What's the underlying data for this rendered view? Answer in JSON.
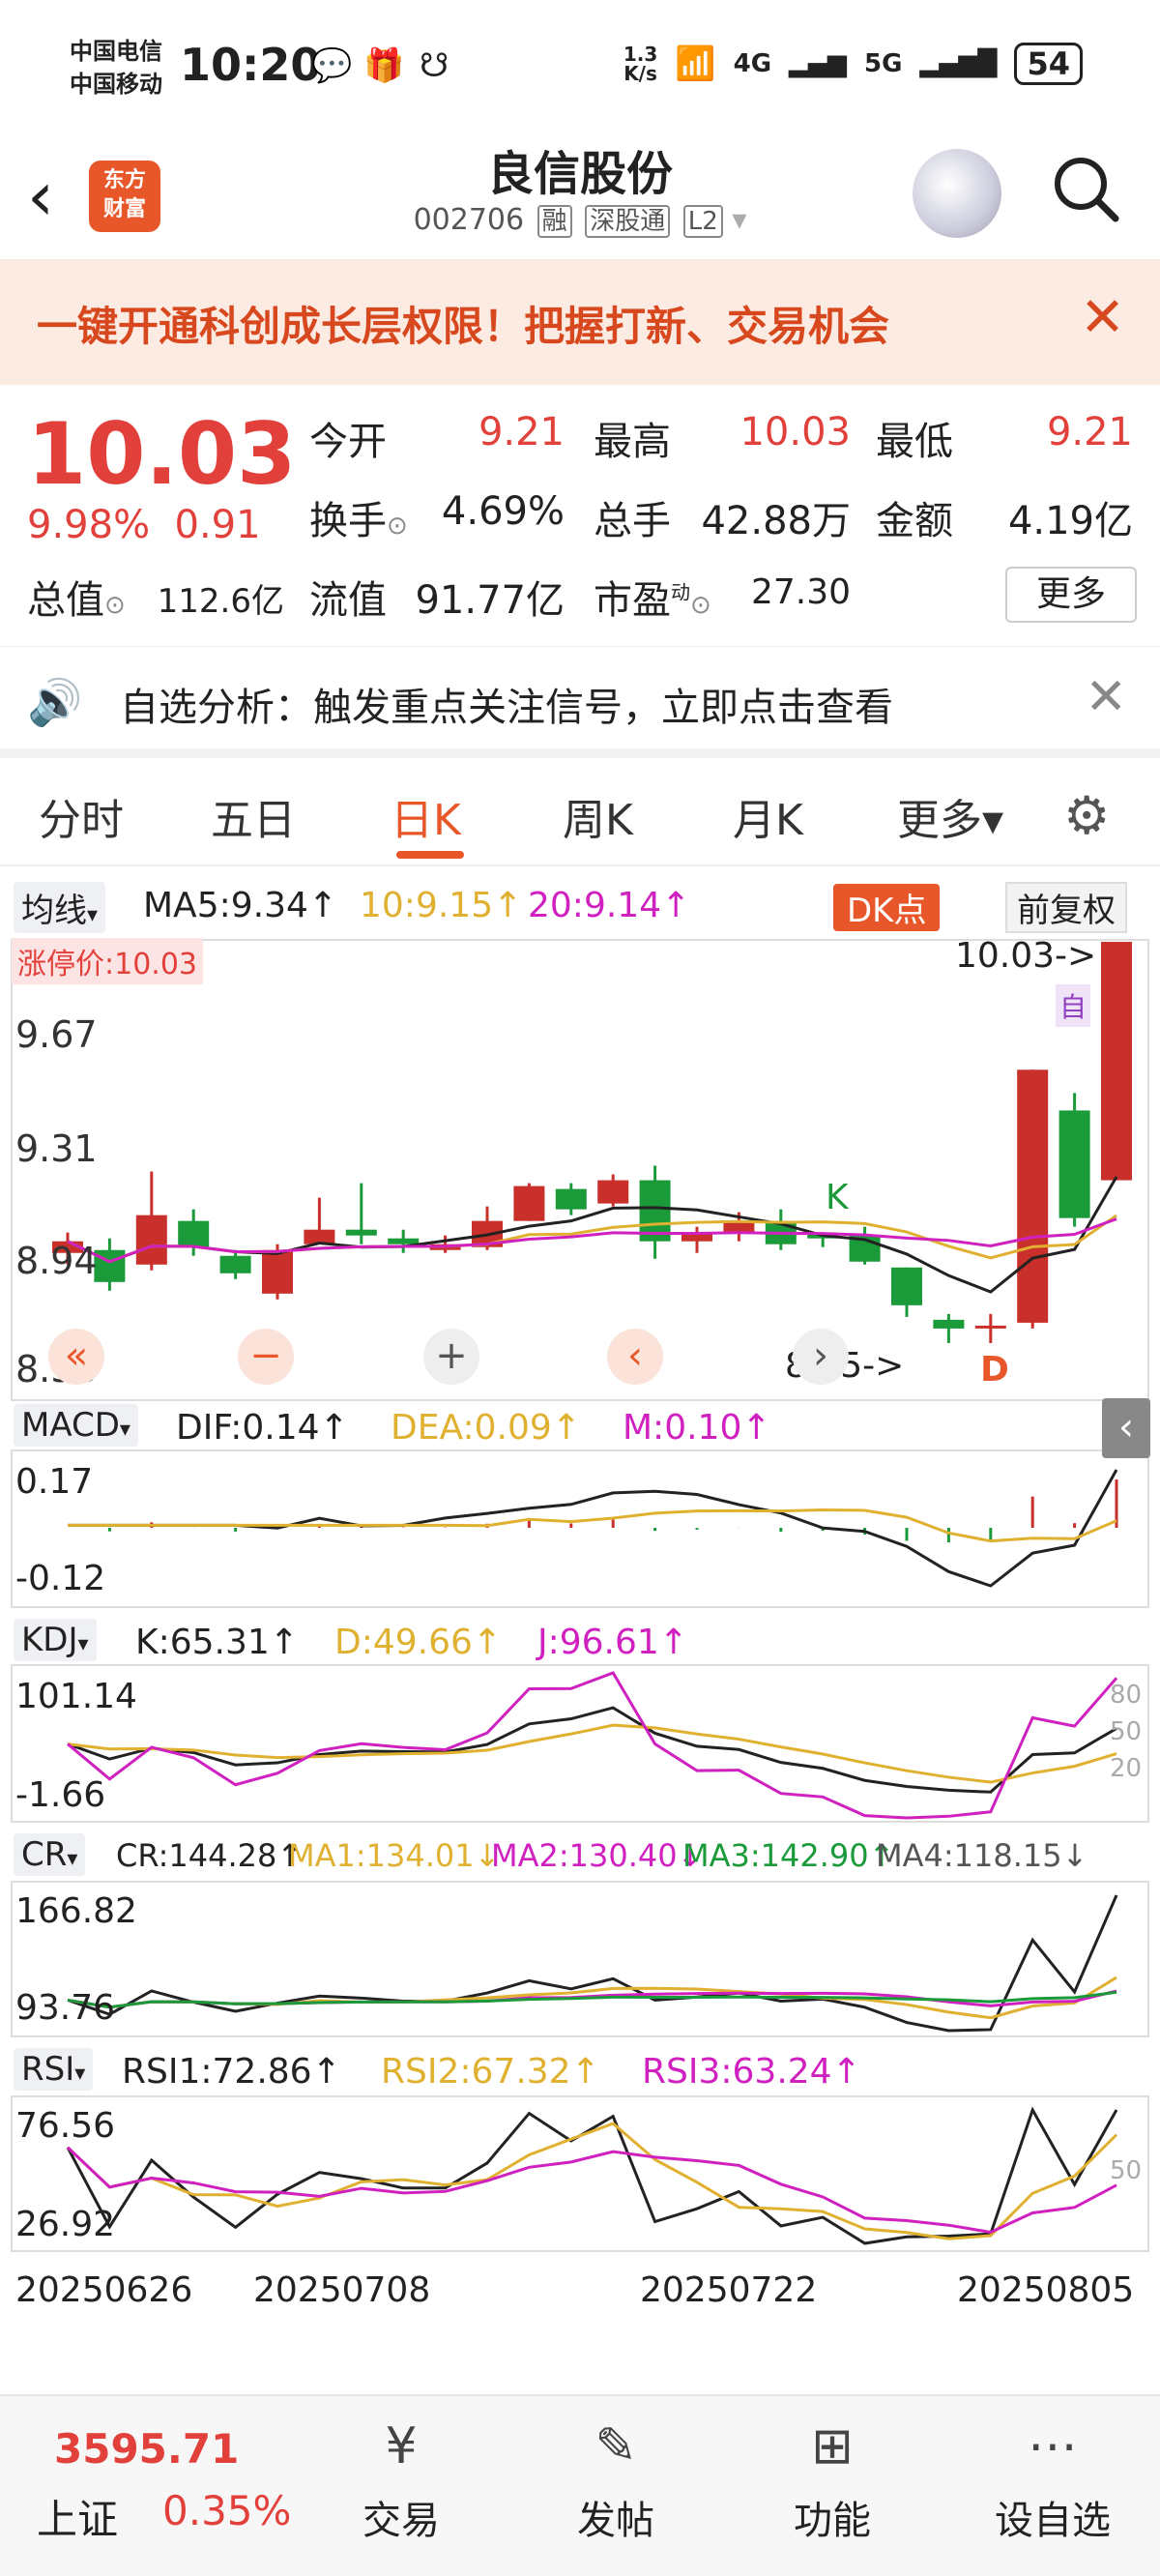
{
  "status": {
    "carrier1": "中国电信",
    "carrier2": "中国移动",
    "time": "10:20",
    "speed_value": "1.3",
    "speed_unit": "K/s",
    "net1": "4G",
    "net2": "5G",
    "battery": "54"
  },
  "header": {
    "name": "良信股份",
    "code": "002706",
    "tags": [
      "融",
      "深股通",
      "L2"
    ]
  },
  "banner": {
    "text": "一键开通科创成长层权限！把握打新、交易机会"
  },
  "quote": {
    "price": "10.03",
    "change_pct": "9.98%",
    "change": "0.91",
    "fields": [
      {
        "label": "今开",
        "value": "9.21",
        "color": "#e2403a"
      },
      {
        "label": "最高",
        "value": "10.03",
        "color": "#e2403a"
      },
      {
        "label": "最低",
        "value": "9.21",
        "color": "#e2403a"
      },
      {
        "label": "换手",
        "value": "4.69%",
        "color": "#222"
      },
      {
        "label": "总手",
        "value": "42.88万",
        "color": "#222"
      },
      {
        "label": "金额",
        "value": "4.19亿",
        "color": "#222"
      },
      {
        "label": "总值",
        "value": "112.6亿",
        "color": "#222"
      },
      {
        "label": "流值",
        "value": "91.77亿",
        "color": "#222"
      },
      {
        "label": "市盈",
        "value": "27.30",
        "color": "#222"
      }
    ],
    "pe_sup": "动",
    "more_label": "更多"
  },
  "ad": {
    "text": "自选分析：触发重点关注信号，立即点击查看"
  },
  "tabs": [
    {
      "label": "分时"
    },
    {
      "label": "五日"
    },
    {
      "label": "日K"
    },
    {
      "label": "周K"
    },
    {
      "label": "月K"
    },
    {
      "label": "更多▾"
    }
  ],
  "ma_bar": {
    "dropdown": "均线",
    "ma5": "MA5:9.34↑",
    "ma10": "10:9.15↑",
    "ma20": "20:9.14↑",
    "dk": "DK点",
    "adj": "前复权"
  },
  "kline": {
    "limit_label": "涨停价:10.03",
    "y_labels": [
      "9.67",
      "9.31",
      "8.94",
      "8.58"
    ],
    "high_marker": "10.03->",
    "low_marker": "8.65->",
    "k_mark": "K",
    "d_mark": "D",
    "zi_mark": "自"
  },
  "macd": {
    "dropdown": "MACD",
    "dif": "DIF:0.14↑",
    "dea": "DEA:0.09↑",
    "m": "M:0.10↑",
    "y_top": "0.17",
    "y_bot": "-0.12"
  },
  "kdj": {
    "dropdown": "KDJ",
    "k": "K:65.31↑",
    "d": "D:49.66↑",
    "j": "J:96.61↑",
    "y_top": "101.14",
    "y_bot": "-1.66",
    "lv80": "80",
    "lv50": "50",
    "lv20": "20"
  },
  "cr": {
    "dropdown": "CR",
    "cr": "CR:144.28↑",
    "ma1": "MA1:134.01↓",
    "ma2": "MA2:130.40↓",
    "ma3": "MA3:142.90↑",
    "ma4": "MA4:118.15↓",
    "y_top": "166.82",
    "y_bot": "93.76"
  },
  "rsi": {
    "dropdown": "RSI",
    "rsi1": "RSI1:72.86↑",
    "rsi2": "RSI2:67.32↑",
    "rsi3": "RSI3:63.24↑",
    "y_top": "76.56",
    "y_bot": "26.92",
    "lv50": "50"
  },
  "dates": [
    "20250626",
    "20250708",
    "20250722",
    "20250805"
  ],
  "bottom": {
    "index_value": "3595.71",
    "index_name": "上证",
    "index_pct": "0.35%",
    "items": [
      "交易",
      "发帖",
      "功能",
      "设自选"
    ]
  },
  "chart_data": {
    "type": "candlestick",
    "candles": [
      {
        "o": 8.96,
        "c": 9.0,
        "h": 9.03,
        "l": 8.92
      },
      {
        "o": 8.97,
        "c": 8.86,
        "h": 9.01,
        "l": 8.83
      },
      {
        "o": 8.92,
        "c": 9.09,
        "h": 9.24,
        "l": 8.9
      },
      {
        "o": 9.07,
        "c": 8.98,
        "h": 9.11,
        "l": 8.95
      },
      {
        "o": 8.95,
        "c": 8.89,
        "h": 8.97,
        "l": 8.87
      },
      {
        "o": 8.82,
        "c": 8.97,
        "h": 8.99,
        "l": 8.8
      },
      {
        "o": 8.99,
        "c": 9.04,
        "h": 9.15,
        "l": 8.99
      },
      {
        "o": 9.04,
        "c": 9.02,
        "h": 9.2,
        "l": 8.99
      },
      {
        "o": 9.01,
        "c": 8.99,
        "h": 9.04,
        "l": 8.96
      },
      {
        "o": 8.97,
        "c": 8.99,
        "h": 9.02,
        "l": 8.96
      },
      {
        "o": 8.98,
        "c": 9.07,
        "h": 9.12,
        "l": 8.97
      },
      {
        "o": 9.07,
        "c": 9.19,
        "h": 9.2,
        "l": 9.07
      },
      {
        "o": 9.18,
        "c": 9.11,
        "h": 9.2,
        "l": 9.09
      },
      {
        "o": 9.13,
        "c": 9.21,
        "h": 9.23,
        "l": 9.12
      },
      {
        "o": 9.21,
        "c": 9.0,
        "h": 9.26,
        "l": 8.94
      },
      {
        "o": 9.0,
        "c": 9.03,
        "h": 9.05,
        "l": 8.96
      },
      {
        "o": 9.03,
        "c": 9.07,
        "h": 9.1,
        "l": 9.0
      },
      {
        "o": 9.07,
        "c": 8.99,
        "h": 9.11,
        "l": 8.97
      },
      {
        "o": 9.03,
        "c": 9.01,
        "h": 9.03,
        "l": 8.98
      },
      {
        "o": 9.02,
        "c": 8.93,
        "h": 9.05,
        "l": 8.92
      },
      {
        "o": 8.91,
        "c": 8.78,
        "h": 8.91,
        "l": 8.74
      },
      {
        "o": 8.73,
        "c": 8.7,
        "h": 8.75,
        "l": 8.65
      },
      {
        "o": 8.71,
        "c": 8.71,
        "h": 8.75,
        "l": 8.65
      },
      {
        "o": 8.72,
        "c": 9.59,
        "h": 9.59,
        "l": 8.7
      },
      {
        "o": 9.45,
        "c": 9.08,
        "h": 9.51,
        "l": 9.05
      },
      {
        "o": 9.21,
        "c": 10.03,
        "h": 10.03,
        "l": 9.21
      }
    ]
  }
}
